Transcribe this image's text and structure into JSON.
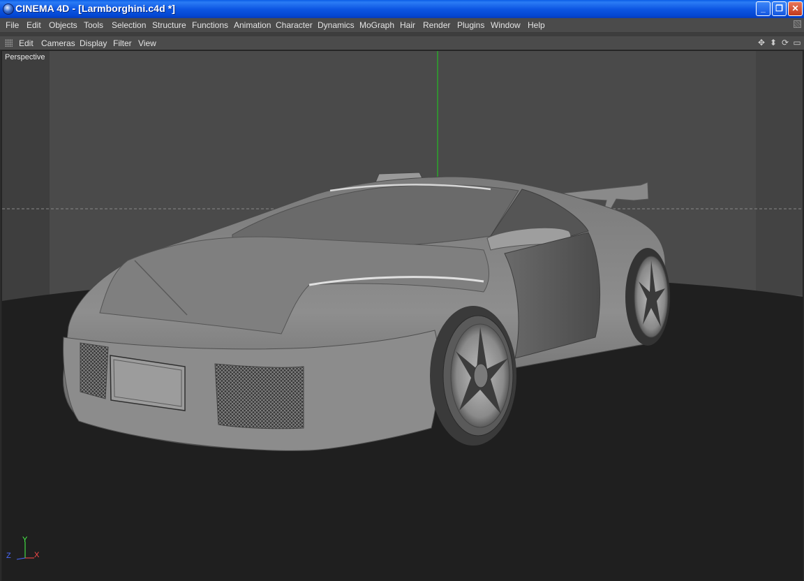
{
  "window": {
    "title": "CINEMA 4D - [Larmborghini.c4d *]",
    "buttons": {
      "minimize": "_",
      "restore": "❐",
      "close": "✕"
    }
  },
  "menu": [
    "File",
    "Edit",
    "Objects",
    "Tools",
    "Selection",
    "Structure",
    "Functions",
    "Animation",
    "Character",
    "Dynamics",
    "MoGraph",
    "Hair",
    "Render",
    "Plugins",
    "Window",
    "Help"
  ],
  "viewport_menu": [
    "Edit",
    "Cameras",
    "Display",
    "Filter",
    "View"
  ],
  "viewport": {
    "label": "Perspective",
    "axes": {
      "y": "Y",
      "z": "Z",
      "x": "X"
    },
    "colors": {
      "x_axis": "#ff4a4a",
      "y_axis": "#4aff4a",
      "z_axis": "#4a6aff",
      "background": "#4a4a4a",
      "floor": "#1f1f1f"
    }
  },
  "icons": {
    "viewport_nav": [
      "move-view-icon",
      "zoom-view-icon",
      "rotate-view-icon",
      "maximize-view-icon"
    ],
    "menu_corner": "layout-grip-icon"
  },
  "colors": {
    "titlebar": "#0a5ce6",
    "menubar": "#4b4b4b",
    "menu_text": "#e4e4e4"
  }
}
